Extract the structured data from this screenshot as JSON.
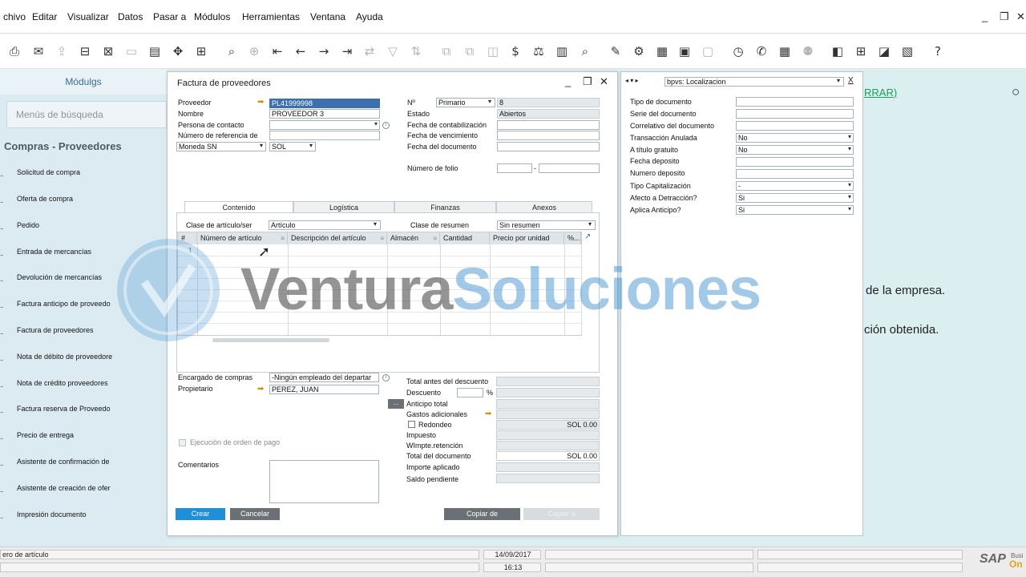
{
  "menu": {
    "items": [
      "chivo",
      "Editar",
      "Visualizar",
      "Datos",
      "Pasar a",
      "Módulos",
      "Herramientas",
      "Ventana",
      "Ayuda"
    ],
    "win_minimize": "_",
    "win_restore": "❐",
    "win_close": "✕"
  },
  "toolbar": {
    "icons": [
      "printer-icon",
      "print-preview-icon",
      "email-icon",
      "send-icon",
      "print-icon",
      "excel-export-icon",
      "word-export-icon",
      "pdf-export-icon",
      "move-icon",
      "form-settings-icon",
      "find-icon",
      "add-icon",
      "first-record-icon",
      "previous-record-icon",
      "next-record-icon",
      "last-record-icon",
      "refresh-icon",
      "filter-icon",
      "sort-icon",
      "base-document-icon",
      "target-document-icon",
      "gross-profit-icon",
      "payment-means-icon",
      "volume-weight-icon",
      "journal-icon",
      "preview-icon",
      "edit-icon",
      "settings-icon",
      "document-settings-icon",
      "messages-icon",
      "notes-icon",
      "alerts-icon",
      "activity-icon",
      "calendar-icon",
      "contacts-icon",
      "dashboard-icon",
      "widgets-icon",
      "cockpit-icon",
      "reports-icon",
      "help-icon"
    ]
  },
  "sidebar": {
    "tab_label": "Módulgs",
    "search_placeholder": "Menús de búsqueda",
    "section_title": "Compras - Proveedores",
    "items": [
      "Solicitud de compra",
      "Oferta de compra",
      "Pedido",
      "Entrada de mercancías",
      "Devolución de mercancías",
      "Factura anticipo de proveedo",
      "Factura de proveedores",
      "Nota de débito de proveedore",
      "Nota de crédito proveedores",
      "Factura reserva de Proveedo",
      "Precio de entrega",
      "Asistente de confirmación de",
      "Asistente de creación de ofer",
      "Impresión documento"
    ]
  },
  "background": {
    "link": "RRAR)",
    "line1": "de la empresa.",
    "line2": "ción obtenida."
  },
  "invoice": {
    "title": "Factura de proveedores",
    "labels": {
      "proveedor": "Proveedor",
      "nombre": "Nombre",
      "persona": "Persona de contacto",
      "numref": "Número de referencia de",
      "no": "Nº",
      "estado": "Estado",
      "fcontab": "Fecha de contabilización",
      "fvenc": "Fecha de vencimiento",
      "fdoc": "Fecha del documento",
      "folio": "Número de folio",
      "folio_sep": "-"
    },
    "values": {
      "proveedor": "PL41999998",
      "nombre": "PROVEEDOR 3",
      "moneda": "Moneda SN",
      "moneda_val": "SOL",
      "series": "Primario",
      "numero": "8",
      "estado": "Abiertos"
    },
    "tabs": [
      "Contenido",
      "Logística",
      "Finanzas",
      "Anexos"
    ],
    "clase_label": "Clase de artículo/ser",
    "clase_value": "Artículo",
    "resumen_label": "Clase de resumen",
    "resumen_value": "Sin resumen",
    "columns": [
      "#",
      "Número de artículo",
      "Descripción del artículo",
      "Almacén",
      "Cantidad",
      "Precio por unidad",
      "%..."
    ],
    "row1": "1",
    "encargado_label": "Encargado de compras",
    "encargado_value": "-Ningún empleado del departar",
    "propietario_label": "Propietario",
    "propietario_value": "PEREZ, JUAN",
    "ejecucion_label": "Ejecución de orden de pago",
    "comentarios_label": "Comentarios",
    "totals": {
      "antes": "Total antes del descuento",
      "descuento": "Descuento",
      "percent": "%",
      "anticipo": "Anticipo total",
      "gastos": "Gastos adicionales",
      "redondeo": "Redondeo",
      "redondeo_val": "SOL 0.00",
      "impuesto": "Impuesto",
      "wimpte": "WImpte.retención",
      "total": "Total del documento",
      "total_val": "SOL 0.00",
      "importe": "Importe aplicado",
      "saldo": "Saldo pendiente",
      "ellipsis": "..."
    },
    "buttons": {
      "crear": "Crear",
      "cancelar": "Cancelar",
      "copiar_de": "Copiar de",
      "copiar_a": "Copiar a"
    }
  },
  "udf": {
    "nav": "◂ ▾ ▸",
    "combo": "bpvs: Localizacion",
    "close": "X",
    "fields": [
      {
        "label": "Tipo de documento",
        "value": ""
      },
      {
        "label": "Serie del documento",
        "value": ""
      },
      {
        "label": "Correlativo del documento",
        "value": ""
      },
      {
        "label": "Transacción Anulada",
        "value": "No"
      },
      {
        "label": "A título gratuito",
        "value": "No"
      },
      {
        "label": "Fecha deposito",
        "value": ""
      },
      {
        "label": "Numero deposito",
        "value": ""
      },
      {
        "label": "Tipo Capitalización",
        "value": "-"
      },
      {
        "label": "Afecto a Detracción?",
        "value": "Si"
      },
      {
        "label": "Aplica Anticipo?",
        "value": "Si"
      }
    ]
  },
  "status": {
    "message": "ero de artículo",
    "date": "14/09/2017",
    "time": "16:13",
    "brand": "SAP",
    "brand_sub1": "Busi",
    "brand_sub2": "On"
  },
  "watermark": {
    "part1": "Ventura",
    "part2": "Soluciones"
  }
}
